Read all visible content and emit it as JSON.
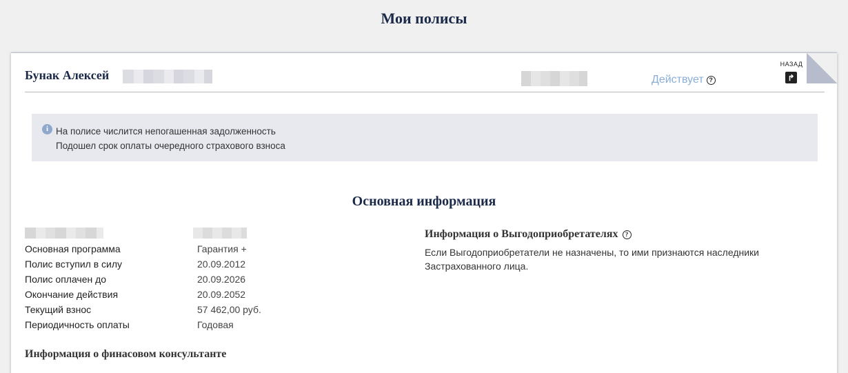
{
  "page": {
    "title": "Мои полисы"
  },
  "policy": {
    "holder_name": "Бунак Алексей",
    "status": "Действует",
    "status_color": "#8aaed6",
    "back_label": "НАЗАД"
  },
  "alert": {
    "lines": [
      "На полисе числится непогашенная задолженность",
      "Подошел срок оплаты очередного страхового взноса"
    ]
  },
  "main_info": {
    "title": "Основная информация",
    "rows": [
      {
        "label": "Основная программа",
        "value": "Гарантия +"
      },
      {
        "label": "Полис вступил в силу",
        "value": "20.09.2012"
      },
      {
        "label": "Полис оплачен до",
        "value": "20.09.2026"
      },
      {
        "label": "Окончание действия",
        "value": "20.09.2052"
      },
      {
        "label": "Текущий взнос",
        "value": "57 462,00 руб."
      },
      {
        "label": "Периодичность оплаты",
        "value": "Годовая"
      }
    ]
  },
  "beneficiaries": {
    "title": "Информация о Выгодоприобретателях",
    "text": "Если Выгодоприобретатели не назначены, то ими признаются наследники Застрахованного лица."
  },
  "consultant": {
    "title": "Информация о финасовом консультанте"
  },
  "colors": {
    "heading": "#1c2a4a",
    "alert_bg": "#e8e9ef",
    "info_icon": "#8fa8cc"
  },
  "icons": [
    "info-icon",
    "help-icon",
    "back-arrow-icon"
  ]
}
